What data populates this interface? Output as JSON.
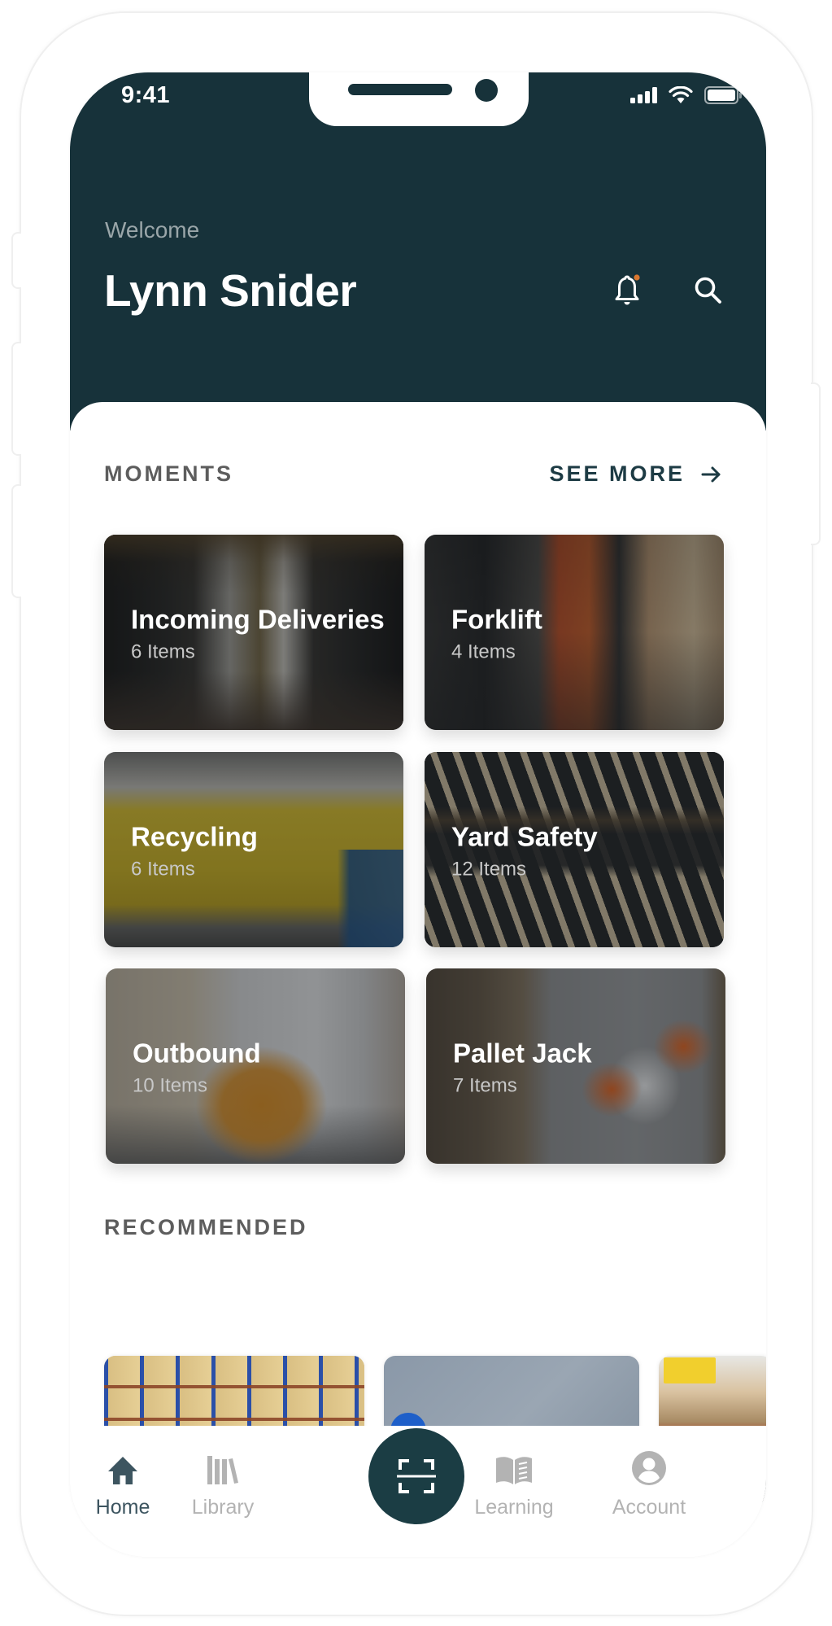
{
  "status_bar": {
    "time": "9:41",
    "signal_icon": "cellular-signal-icon",
    "wifi_icon": "wifi-icon",
    "battery_icon": "battery-icon"
  },
  "header": {
    "greeting": "Welcome",
    "user_name": "Lynn Snider",
    "notification_icon": "bell-icon",
    "notification_badge_color": "#d9772f",
    "search_icon": "search-icon"
  },
  "colors": {
    "brand_dark": "#17323a",
    "accent_text": "#1d3b44",
    "section_title": "#5d5d5d",
    "inactive_nav": "#b3b3b3"
  },
  "moments": {
    "title": "MOMENTS",
    "see_more_label": "SEE MORE",
    "see_more_icon": "arrow-right-icon",
    "cards": [
      {
        "title": "Incoming Deliveries",
        "count": "6 Items",
        "image": "truck-trailer-loading-dock"
      },
      {
        "title": "Forklift",
        "count": "4 Items",
        "image": "orange-forklift-lumber"
      },
      {
        "title": "Recycling",
        "count": "6 Items",
        "image": "yellow-dumpster"
      },
      {
        "title": "Yard Safety",
        "count": "12 Items",
        "image": "wood-planks-pattern"
      },
      {
        "title": "Outbound",
        "count": "10 Items",
        "image": "forklift-truck-loading"
      },
      {
        "title": "Pallet Jack",
        "count": "7 Items",
        "image": "workers-pallet-aerial"
      }
    ]
  },
  "recommended": {
    "title": "RECOMMENDED",
    "cards": [
      {
        "image": "warehouse-racks-blue"
      },
      {
        "image": "worker-pallet-jack-aerial"
      },
      {
        "image": "warehouse-shelving-red"
      }
    ]
  },
  "bottom_nav": {
    "items": [
      {
        "label": "Home",
        "icon": "home-icon",
        "active": true
      },
      {
        "label": "Library",
        "icon": "library-icon",
        "active": false
      },
      {
        "label": "",
        "icon": "scan-icon",
        "active": false
      },
      {
        "label": "Learning",
        "icon": "open-book-icon",
        "active": false
      },
      {
        "label": "Account",
        "icon": "account-icon",
        "active": false
      }
    ]
  }
}
